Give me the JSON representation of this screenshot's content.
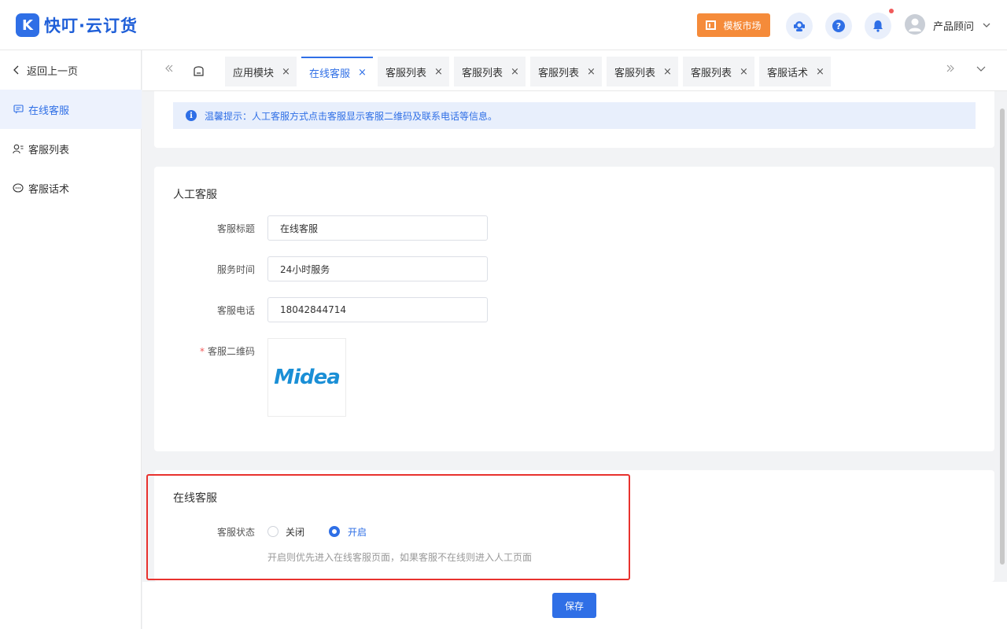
{
  "header": {
    "logo_mark": "K",
    "app_name": "快叮·云订货",
    "template_market": "模板市场",
    "user_name": "产品顾问"
  },
  "sidebar": {
    "back": "返回上一页",
    "items": [
      {
        "label": "在线客服",
        "icon": "message-icon",
        "active": true
      },
      {
        "label": "客服列表",
        "icon": "user-list-icon",
        "active": false
      },
      {
        "label": "客服话术",
        "icon": "chat-icon",
        "active": false
      }
    ]
  },
  "tabs": [
    {
      "label": "应用模块",
      "active": false
    },
    {
      "label": "在线客服",
      "active": true
    },
    {
      "label": "客服列表",
      "active": false
    },
    {
      "label": "客服列表",
      "active": false
    },
    {
      "label": "客服列表",
      "active": false
    },
    {
      "label": "客服列表",
      "active": false
    },
    {
      "label": "客服列表",
      "active": false
    },
    {
      "label": "客服话术",
      "active": false
    }
  ],
  "tip": "温馨提示：人工客服方式点击客服显示客服二维码及联系电话等信息。",
  "manual": {
    "title": "人工客服",
    "fields": [
      {
        "label": "客服标题",
        "value": "在线客服"
      },
      {
        "label": "服务时间",
        "value": "24小时服务"
      },
      {
        "label": "客服电话",
        "value": "18042844714"
      }
    ],
    "qr_label": "客服二维码",
    "qr_required_mark": "*",
    "qr_image_text": "Midea"
  },
  "online": {
    "title": "在线客服",
    "status_label": "客服状态",
    "options": [
      {
        "label": "关闭",
        "selected": false
      },
      {
        "label": "开启",
        "selected": true
      }
    ],
    "hint": "开启则优先进入在线客服页面，如果客服不在线则进入人工页面"
  },
  "footer": {
    "save": "保存"
  },
  "colors": {
    "primary": "#2f6fe6",
    "accent_orange": "#f58b3a",
    "highlight_red": "#e8322e"
  }
}
